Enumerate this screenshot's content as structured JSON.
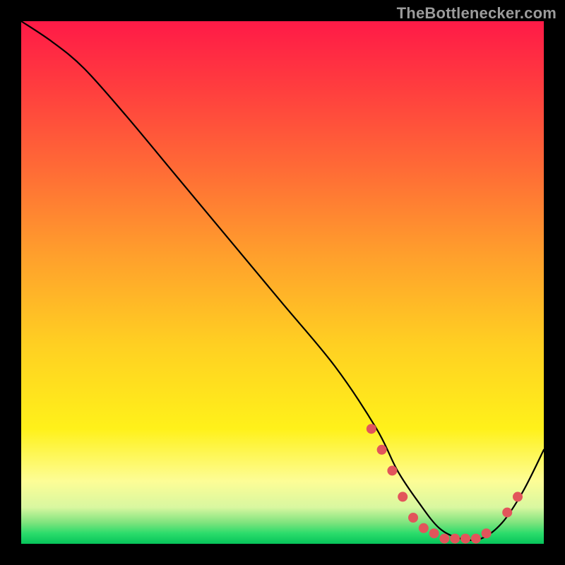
{
  "attribution": "TheBottlenecker.com",
  "chart_data": {
    "type": "line",
    "title": "",
    "xlabel": "",
    "ylabel": "",
    "xlim": [
      0,
      100
    ],
    "ylim": [
      0,
      100
    ],
    "series": [
      {
        "name": "bottleneck-curve",
        "x": [
          0,
          6,
          12,
          20,
          30,
          40,
          50,
          60,
          68,
          72,
          76,
          80,
          84,
          88,
          92,
          96,
          100
        ],
        "values": [
          100,
          96,
          91,
          82,
          70,
          58,
          46,
          34,
          22,
          14,
          8,
          3,
          1,
          1,
          4,
          10,
          18
        ]
      }
    ],
    "markers": {
      "name": "highlight-dots",
      "color": "#e2555b",
      "points": [
        {
          "x": 67,
          "y": 22
        },
        {
          "x": 69,
          "y": 18
        },
        {
          "x": 71,
          "y": 14
        },
        {
          "x": 73,
          "y": 9
        },
        {
          "x": 75,
          "y": 5
        },
        {
          "x": 77,
          "y": 3
        },
        {
          "x": 79,
          "y": 2
        },
        {
          "x": 81,
          "y": 1
        },
        {
          "x": 83,
          "y": 1
        },
        {
          "x": 85,
          "y": 1
        },
        {
          "x": 87,
          "y": 1
        },
        {
          "x": 89,
          "y": 2
        },
        {
          "x": 93,
          "y": 6
        },
        {
          "x": 95,
          "y": 9
        }
      ]
    }
  }
}
